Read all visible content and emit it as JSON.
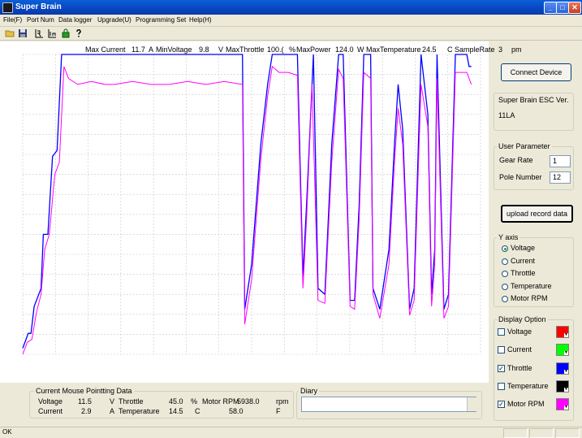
{
  "window": {
    "title": "Super Brain",
    "buttons": {
      "minimize": "_",
      "maximize": "□",
      "close": "✕"
    }
  },
  "menu": [
    "File(F)",
    "Port Num",
    "Data logger",
    "Upgrade(U)",
    "Programming Set",
    "Help(H)"
  ],
  "toolbar_icons": [
    "open-folder-icon",
    "save-disk-icon",
    "chart-r-icon",
    "chart-up-icon",
    "lock-icon",
    "help-question-icon"
  ],
  "chart_header": {
    "max_current_label": "Max Current",
    "max_current_value": "11.7",
    "max_current_unit": "A",
    "min_voltage_label": "MinVoltage",
    "min_voltage_value": "9.8",
    "min_voltage_unit": "V",
    "max_throttle_label": "MaxThrottle",
    "max_throttle_value": "100.(",
    "max_throttle_unit": "%",
    "max_power_label": "MaxPower",
    "max_power_value": "124.0",
    "max_power_unit": "W",
    "max_temp_label": "MaxTemperature",
    "max_temp_value": "24.5",
    "max_temp_unit": "C",
    "sample_rate_label": "SampleRate",
    "sample_rate_value": "3",
    "sample_rate_unit": "pm"
  },
  "chart_data": {
    "type": "line",
    "ylim": [
      0,
      100
    ],
    "xlim": [
      0,
      1
    ],
    "grid": true,
    "series": [
      {
        "color": "#0000ff",
        "x": [
          0.0,
          0.01,
          0.02,
          0.025,
          0.04,
          0.05,
          0.06,
          0.08,
          0.09,
          0.1,
          1.0
        ],
        "points": [
          [
            0.0,
            2
          ],
          [
            0.012,
            7
          ],
          [
            0.018,
            7
          ],
          [
            0.025,
            16
          ],
          [
            0.04,
            22
          ],
          [
            0.045,
            40
          ],
          [
            0.055,
            40
          ],
          [
            0.065,
            66
          ],
          [
            0.075,
            68
          ],
          [
            0.085,
            100
          ],
          [
            0.48,
            100
          ],
          [
            0.485,
            15
          ],
          [
            0.5,
            30
          ],
          [
            0.52,
            70
          ],
          [
            0.535,
            90
          ],
          [
            0.545,
            100
          ],
          [
            0.6,
            100
          ],
          [
            0.612,
            26
          ],
          [
            0.62,
            50
          ],
          [
            0.635,
            100
          ],
          [
            0.645,
            22
          ],
          [
            0.66,
            20
          ],
          [
            0.675,
            70
          ],
          [
            0.69,
            100
          ],
          [
            0.7,
            100
          ],
          [
            0.715,
            18
          ],
          [
            0.725,
            18
          ],
          [
            0.735,
            50
          ],
          [
            0.745,
            100
          ],
          [
            0.76,
            100
          ],
          [
            0.765,
            22
          ],
          [
            0.78,
            15
          ],
          [
            0.8,
            35
          ],
          [
            0.812,
            70
          ],
          [
            0.82,
            90
          ],
          [
            0.83,
            75
          ],
          [
            0.845,
            15
          ],
          [
            0.855,
            22
          ],
          [
            0.87,
            100
          ],
          [
            0.885,
            80
          ],
          [
            0.893,
            20
          ],
          [
            0.9,
            35
          ],
          [
            0.905,
            100
          ],
          [
            0.92,
            15
          ],
          [
            0.93,
            20
          ],
          [
            0.945,
            100
          ],
          [
            0.97,
            100
          ],
          [
            0.975,
            96
          ],
          [
            0.98,
            96
          ]
        ]
      },
      {
        "color": "#ff00ff",
        "points": [
          [
            0.0,
            0
          ],
          [
            0.01,
            4
          ],
          [
            0.02,
            5
          ],
          [
            0.03,
            14
          ],
          [
            0.04,
            20
          ],
          [
            0.048,
            35
          ],
          [
            0.058,
            40
          ],
          [
            0.07,
            60
          ],
          [
            0.08,
            64
          ],
          [
            0.09,
            96
          ],
          [
            0.1,
            92
          ],
          [
            0.12,
            90
          ],
          [
            0.15,
            91
          ],
          [
            0.18,
            90
          ],
          [
            0.2,
            90
          ],
          [
            0.24,
            91
          ],
          [
            0.28,
            90
          ],
          [
            0.32,
            90
          ],
          [
            0.36,
            91
          ],
          [
            0.4,
            90
          ],
          [
            0.44,
            91
          ],
          [
            0.48,
            90
          ],
          [
            0.485,
            10
          ],
          [
            0.5,
            25
          ],
          [
            0.52,
            65
          ],
          [
            0.535,
            86
          ],
          [
            0.545,
            96
          ],
          [
            0.56,
            94
          ],
          [
            0.58,
            94
          ],
          [
            0.6,
            93
          ],
          [
            0.612,
            22
          ],
          [
            0.62,
            45
          ],
          [
            0.632,
            90
          ],
          [
            0.645,
            18
          ],
          [
            0.66,
            17
          ],
          [
            0.675,
            64
          ],
          [
            0.69,
            95
          ],
          [
            0.7,
            92
          ],
          [
            0.715,
            16
          ],
          [
            0.725,
            15
          ],
          [
            0.735,
            45
          ],
          [
            0.745,
            94
          ],
          [
            0.76,
            92
          ],
          [
            0.765,
            20
          ],
          [
            0.78,
            12
          ],
          [
            0.8,
            30
          ],
          [
            0.812,
            64
          ],
          [
            0.82,
            82
          ],
          [
            0.83,
            70
          ],
          [
            0.845,
            13
          ],
          [
            0.855,
            18
          ],
          [
            0.87,
            90
          ],
          [
            0.885,
            76
          ],
          [
            0.893,
            16
          ],
          [
            0.9,
            30
          ],
          [
            0.905,
            92
          ],
          [
            0.92,
            12
          ],
          [
            0.93,
            16
          ],
          [
            0.945,
            94
          ],
          [
            0.97,
            94
          ],
          [
            0.98,
            90
          ]
        ]
      }
    ]
  },
  "right_panel": {
    "connect_button": "Connect Device",
    "esc_version_title": "Super Brain ESC Ver.",
    "esc_version_value": "11LA",
    "user_parameter": {
      "title": "User Parameter",
      "gear_rate_label": "Gear Rate",
      "gear_rate_value": "1",
      "pole_number_label": "Pole Number",
      "pole_number_value": "12"
    },
    "upload_button": "upload record data",
    "y_axis": {
      "title": "Y axis",
      "options": [
        "Voltage",
        "Current",
        "Throttle",
        "Temperature",
        "Motor RPM"
      ],
      "selected_index": 0
    },
    "display_option": {
      "title": "Display Option",
      "items": [
        {
          "label": "Voltage",
          "checked": false,
          "color": "#ff0000"
        },
        {
          "label": "Current",
          "checked": false,
          "color": "#00ff00"
        },
        {
          "label": "Throttle",
          "checked": true,
          "color": "#0000ff"
        },
        {
          "label": "Temperature",
          "checked": false,
          "color": "#000000"
        },
        {
          "label": "Motor RPM",
          "checked": true,
          "color": "#ff00ff"
        }
      ]
    }
  },
  "mouse_data": {
    "title": "Current Mouse Pointting Data",
    "voltage_label": "Voltage",
    "voltage_value": "11.5",
    "voltage_unit": "V",
    "throttle_label": "Throttle",
    "throttle_value": "45.0",
    "throttle_unit": "%",
    "rpm_label": "Motor RPM",
    "rpm_value": "5938.0",
    "rpm_unit": "rpm",
    "current_label": "Current",
    "current_value": "2.9",
    "current_unit": "A",
    "temperature_label": "Temperature",
    "temperature_value": "14.5",
    "temperature_unit": "C",
    "extra_value": "58.0",
    "extra_unit": "F"
  },
  "diary": {
    "title": "Diary",
    "value": ""
  },
  "status": {
    "text": "OK"
  }
}
